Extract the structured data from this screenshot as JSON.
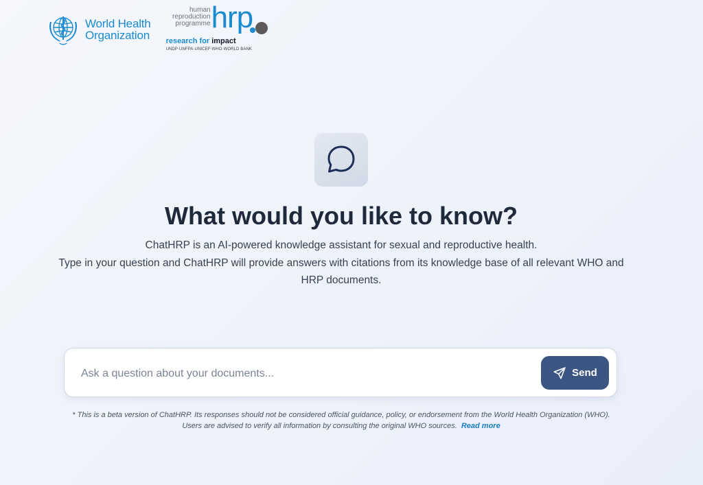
{
  "header": {
    "who_logo": {
      "line1": "World Health",
      "line2": "Organization",
      "color": "#1a8ad1"
    },
    "hrp_logo": {
      "small_lines": [
        "human",
        "reproduction",
        "programme"
      ],
      "big_text": "hrp",
      "tagline_prefix": "research for ",
      "tagline_bold": "impact",
      "partners": "UNDP·UNFPA·UNICEF·WHO·WORLD BANK"
    }
  },
  "hero": {
    "icon": "chat-bubble-icon",
    "title": "What would you like to know?",
    "description_line1": "ChatHRP is an AI-powered knowledge assistant for sexual and reproductive health.",
    "description_line2": "Type in your question and ChatHRP will provide answers with citations from its knowledge base of all relevant WHO and HRP documents."
  },
  "search": {
    "placeholder": "Ask a question about your documents...",
    "value": "",
    "send_label": "Send",
    "send_icon": "send-plane-icon"
  },
  "disclaimer": {
    "text": "* This is a beta version of ChatHRP. Its responses should not be considered official guidance, policy, or endorsement from the World Health Organization (WHO). Users are advised to verify all information by consulting the original WHO sources.",
    "link_label": "Read more"
  },
  "colors": {
    "accent": "#3b5683",
    "brand_blue": "#1a8ad1",
    "title": "#1e293b",
    "background": "#eef2fa"
  }
}
